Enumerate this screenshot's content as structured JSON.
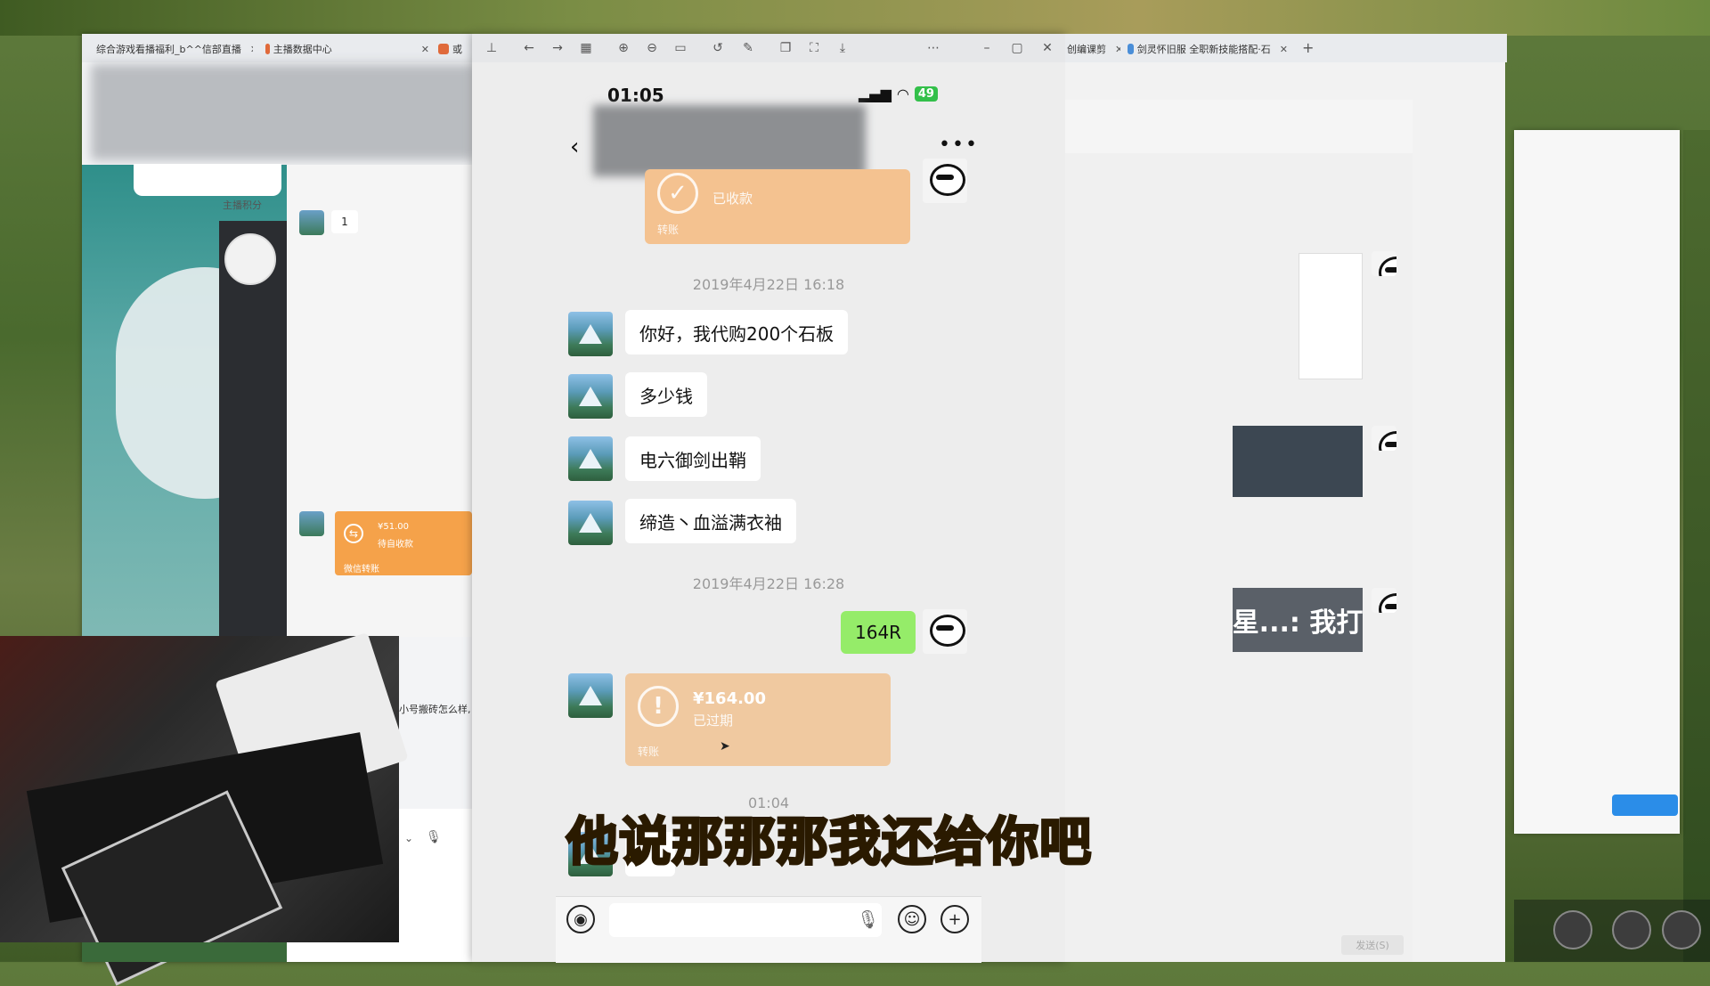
{
  "browser_tabs": [
    {
      "label": "综合游戏看播福利_b^^信部直播"
    },
    {
      "label": "主播数据中心"
    },
    {
      "label": "或"
    }
  ],
  "right_tabs": [
    {
      "label": "创编课剪"
    },
    {
      "label": "剑灵怀旧服 全职新技能搭配·石"
    }
  ],
  "left_window": {
    "score_label": "主播积分",
    "bubble_value": "1",
    "transfer": {
      "amount": "¥51.00",
      "status": "待自收款",
      "footer": "微信转账"
    },
    "snippet": "小号搬砖怎么样,"
  },
  "phone": {
    "time": "01:05",
    "battery": "49",
    "chat": {
      "top_transfer": {
        "status": "已收款",
        "footer": "转账"
      },
      "timestamp1": "2019年4月22日 16:18",
      "messages": [
        {
          "text": "你好，我代购200个石板"
        },
        {
          "text": "多少钱"
        },
        {
          "text": "电六御剑出鞘"
        },
        {
          "text": "缔造丶血溢满衣袖"
        }
      ],
      "timestamp2": "2019年4月22日 16:28",
      "sent_message": "164R",
      "expired_transfer": {
        "amount": "¥164.00",
        "status": "已过期",
        "footer": "转账"
      },
      "timestamp3": "01:04"
    }
  },
  "caption": "他说那那那我还给你吧",
  "right_window": {
    "thumb_text": "星...: 我打",
    "send_button": "发送(S)"
  },
  "colors": {
    "wechat_green": "#95ec69",
    "transfer_orange": "#f5a24a",
    "transfer_expired": "#f0c9a0",
    "caption_yellow": "#ffe23a"
  }
}
